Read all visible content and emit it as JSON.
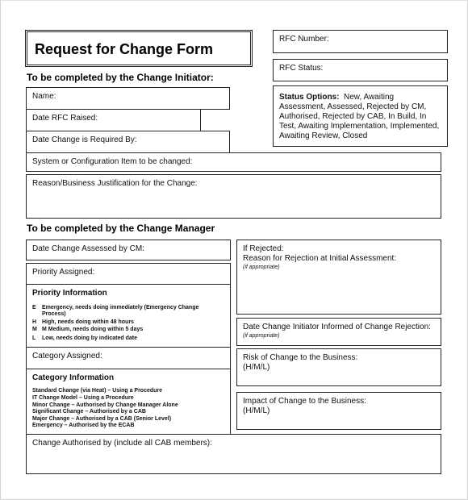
{
  "form": {
    "title": "Request for Change Form",
    "rfc_number_label": "RFC Number:",
    "rfc_status_label": "RFC Status:",
    "status_options": {
      "label": "Status Options:",
      "text": "New, Awaiting Assessment, Assessed, Rejected by CM, Authorised, Rejected by CAB, In Build, In Test, Awaiting Implementation, Implemented, Awaiting Review, Closed",
      "lines": [
        "New, Awaiting",
        "Assessment, Assessed, Rejected by CM,",
        "Authorised, Rejected by CAB, In Build, In",
        "Test, Awaiting Implementation, Implemented,",
        "Awaiting Review, Closed"
      ]
    },
    "initiator_section": {
      "heading": "To be completed by the Change Initiator:",
      "fields": {
        "name": "Name:",
        "date_raised": "Date RFC Raised:",
        "date_required": "Date Change is Required By:",
        "system_item": "System or Configuration Item to be changed:",
        "justification": "Reason/Business Justification for the Change:"
      }
    },
    "manager_section": {
      "heading": "To be completed by the Change Manager",
      "fields": {
        "date_assessed": "Date Change Assessed by CM:",
        "priority_assigned": "Priority Assigned:",
        "category_assigned": "Category Assigned:",
        "authorised_by": "Change Authorised by (include all CAB members):",
        "if_rejected": "If Rejected:",
        "rejection_reason": "Reason for Rejection at Initial Assessment:",
        "rejection_note": "(if appropriate)",
        "date_informed": "Date Change Initiator Informed of Change Rejection:",
        "date_informed_note": "(if appropriate)",
        "risk": "Risk of Change to the Business:",
        "risk_scale": "(H/M/L)",
        "impact": "Impact of Change to the Business:",
        "impact_scale": "(H/M/L)"
      },
      "priority_info": {
        "heading": "Priority Information",
        "items": [
          {
            "code": "E",
            "text": "Emergency, needs doing immediately (Emergency Change"
          },
          {
            "code": "",
            "text": "Process)"
          },
          {
            "code": "H",
            "text": "High, needs doing within 48 hours"
          },
          {
            "code": "M",
            "text": "M  Medium,  needs  doing within 5 days"
          },
          {
            "code": "L",
            "text": "Low, needs doing by indicated date"
          }
        ]
      },
      "category_info": {
        "heading": "Category Information",
        "items": [
          "Standard Change (via Heat) – Using a Procedure",
          "IT Change Model – Using a Procedure",
          "Minor Change – Authorised by Change Manager Alone",
          "Significant Change – Authorised by a CAB",
          "Major Change – Authorised by a CAB (Senior Level)",
          "Emergency – Authorised by the ECAB"
        ]
      }
    }
  }
}
